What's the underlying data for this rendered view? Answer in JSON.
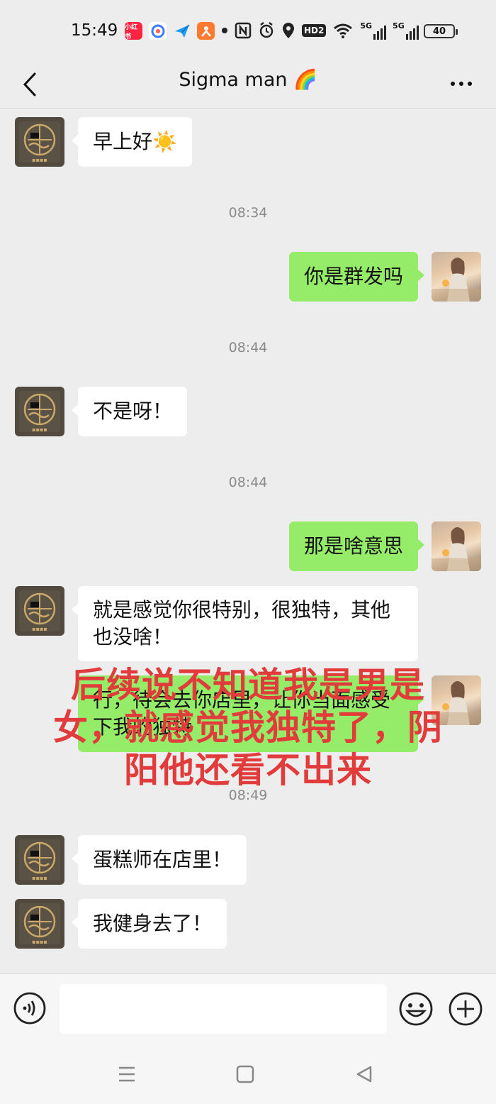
{
  "status_bar": {
    "time": "15:49",
    "app_icons": [
      {
        "name": "xiaohongshu-icon",
        "label": "小红书",
        "color": "#ff2442"
      },
      {
        "name": "browser-icon",
        "label": "",
        "color": "#3d7bff"
      },
      {
        "name": "paper-plane-icon",
        "label": "",
        "color": "#1e9cf0"
      },
      {
        "name": "app-orange-icon",
        "label": "",
        "color": "#ff7a2f"
      }
    ],
    "hd_label": "HD2",
    "network_labels": [
      "5G",
      "5G"
    ],
    "battery": "40"
  },
  "header": {
    "title": "Sigma man 🌈"
  },
  "messages": [
    {
      "type": "incoming",
      "text": "早上好☀️"
    },
    {
      "type": "time",
      "text": "08:34"
    },
    {
      "type": "outgoing",
      "text": "你是群发吗"
    },
    {
      "type": "time",
      "text": "08:44"
    },
    {
      "type": "incoming",
      "text": "不是呀！"
    },
    {
      "type": "time",
      "text": "08:44"
    },
    {
      "type": "outgoing",
      "text": "那是啥意思"
    },
    {
      "type": "incoming",
      "text": "就是感觉你很特别，很独特，其他也没啥！"
    },
    {
      "type": "outgoing",
      "text": "行，待会去你店里，让你当面感受下我的独特"
    },
    {
      "type": "time",
      "text": "08:49"
    },
    {
      "type": "incoming",
      "text": "蛋糕师在店里！"
    },
    {
      "type": "incoming",
      "text": "我健身去了！"
    }
  ],
  "overlay_caption": {
    "lines": [
      "后续说不知道我是男是",
      "女，就感觉我独特了，阴",
      "阳他还看不出来"
    ],
    "color": "#e23b3b"
  },
  "input_bar": {
    "placeholder": ""
  },
  "colors": {
    "background": "#ededed",
    "outgoing_bubble": "#95ec69",
    "incoming_bubble": "#ffffff"
  }
}
